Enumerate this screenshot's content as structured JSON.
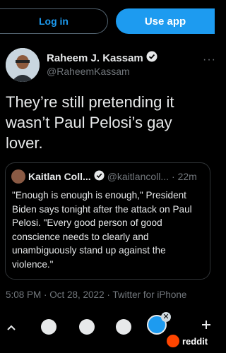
{
  "topbar": {
    "login_label": "Log in",
    "use_app_label": "Use app"
  },
  "tweet": {
    "author_name": "Raheem J. Kassam",
    "author_handle": "@RaheemKassam",
    "text": "They’re still pretending it wasn’t Paul Pelosi’s gay lover.",
    "meta": "5:08 PM · Oct 28, 2022 · Twitter for iPhone"
  },
  "quote": {
    "author_name": "Kaitlan Coll...",
    "author_handle": "@kaitlancoll...",
    "time": "· 22m",
    "text": "\"Enough is enough is enough,\" President Biden says tonight after the attack on Paul Pelosi. \"Every good person of good conscience needs to clearly and unambiguously stand up against the violence.\""
  },
  "watermark": {
    "label": "reddit"
  },
  "colors": {
    "accent": "#1d9bf0",
    "background": "#000000",
    "muted": "#71767b",
    "reddit": "#ff4500"
  }
}
